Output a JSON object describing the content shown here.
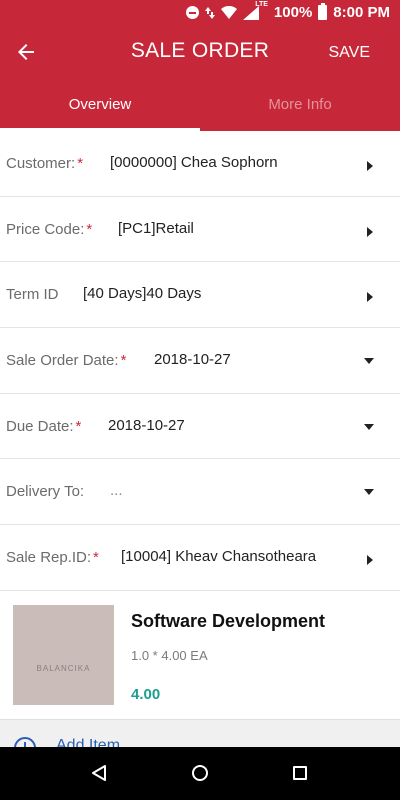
{
  "status_bar": {
    "battery": "100%",
    "time": "8:00 PM",
    "network": "LTE",
    "icons": [
      "do-not-disturb-icon",
      "wifi-icon",
      "signal-icon",
      "battery-icon"
    ]
  },
  "app_bar": {
    "title": "SALE ORDER",
    "save_label": "SAVE",
    "back_icon": "arrow-left-icon",
    "color": "#c6283a"
  },
  "tabs": [
    {
      "label": "Overview",
      "active": true
    },
    {
      "label": "More Info",
      "active": false
    }
  ],
  "fields": [
    {
      "label": "Customer:",
      "required": true,
      "required_mark": "*",
      "value": "[0000000] Chea Sophorn",
      "control": "arrow-right"
    },
    {
      "label": "Price Code:",
      "required": true,
      "required_mark": "*",
      "value": "[PC1]Retail",
      "control": "arrow-right"
    },
    {
      "label": "Term ID",
      "required": false,
      "required_mark": "",
      "value": "[40 Days]40 Days",
      "control": "arrow-right"
    },
    {
      "label": "Sale Order Date:",
      "required": true,
      "required_mark": "*",
      "value": "2018-10-27",
      "control": "dropdown"
    },
    {
      "label": "Due Date:",
      "required": true,
      "required_mark": "*",
      "value": "2018-10-27",
      "control": "dropdown"
    },
    {
      "label": "Delivery To:",
      "required": false,
      "required_mark": "",
      "value": "...",
      "control": "dropdown"
    },
    {
      "label": "Sale Rep.ID:",
      "required": true,
      "required_mark": "*",
      "value": "[10004] Kheav Chansotheara",
      "control": "arrow-right"
    }
  ],
  "product": {
    "thumb_text": "BALANCIKA",
    "name": "Software Development",
    "quantity": "1.0 * 4.00 EA",
    "price": "4.00",
    "price_color": "#1a9e8e"
  },
  "add_item": {
    "label": "Add Item",
    "icon": "add-circle-icon"
  },
  "nav_bar": {
    "icons": [
      "nav-back-icon",
      "nav-home-icon",
      "nav-recents-icon"
    ]
  }
}
